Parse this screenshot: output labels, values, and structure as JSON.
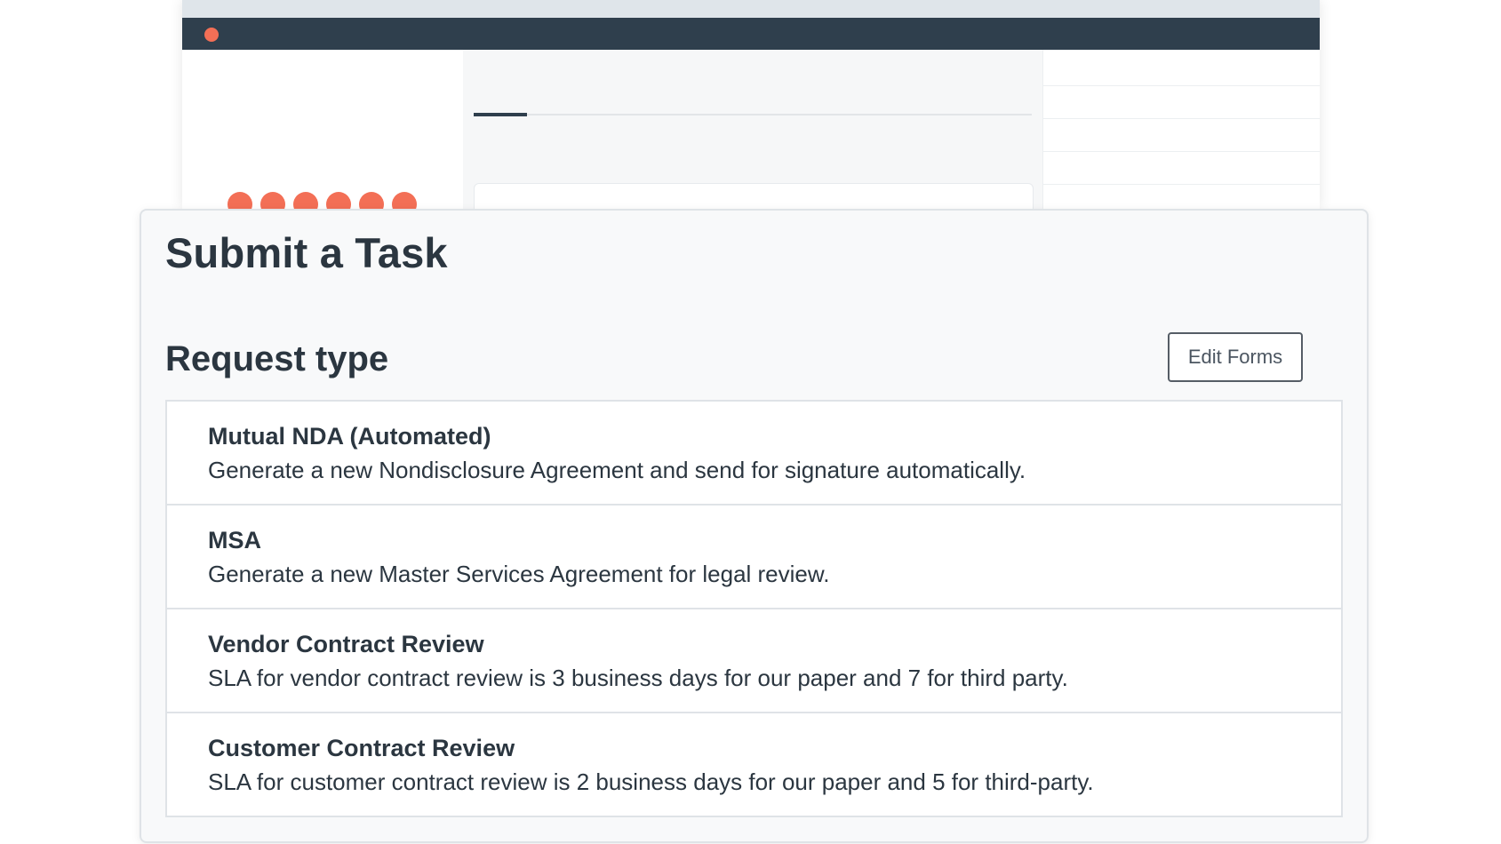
{
  "colors": {
    "accent": "#f36f56",
    "titlebar": "#2f3f4d",
    "text": "#2b3640",
    "border": "#dfe3e7"
  },
  "panel": {
    "title": "Submit a Task",
    "section_title": "Request type",
    "edit_forms_label": "Edit Forms",
    "request_types": [
      {
        "title": "Mutual NDA (Automated)",
        "description": "Generate a new Nondisclosure Agreement and send for signature automatically."
      },
      {
        "title": "MSA",
        "description": "Generate a new Master Services Agreement for legal review."
      },
      {
        "title": "Vendor Contract Review",
        "description": "SLA for vendor contract review is 3 business days for our paper and 7 for third party."
      },
      {
        "title": "Customer Contract Review",
        "description": "SLA for customer contract review is 2 business days for our paper and 5 for third-party."
      }
    ]
  }
}
